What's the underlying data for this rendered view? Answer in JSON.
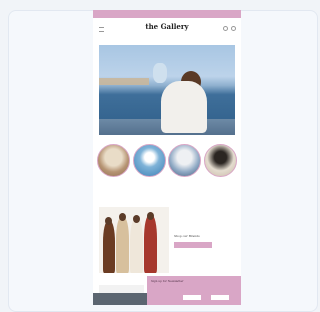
{
  "app": {
    "topbar_links": [
      "",
      "",
      ""
    ],
    "logo": "the Gallery",
    "breadcrumb": ""
  },
  "hero": {
    "alt": ""
  },
  "categories": [
    {
      "label": ""
    },
    {
      "label": ""
    },
    {
      "label": ""
    },
    {
      "label": ""
    }
  ],
  "feature": {
    "title": "Shop our Brands",
    "button_label": ""
  },
  "newsletter": {
    "title": "Sign up for Newsletter",
    "subtitle": "",
    "input_placeholder": "",
    "buttons": [
      "",
      ""
    ]
  },
  "cookie_bar": {
    "text": ""
  },
  "icons": {
    "menu": "menu-icon",
    "search": "search-icon",
    "cart": "cart-icon"
  },
  "colors": {
    "accent": "#d9a6c6",
    "page_background": "#f1f4f8"
  }
}
